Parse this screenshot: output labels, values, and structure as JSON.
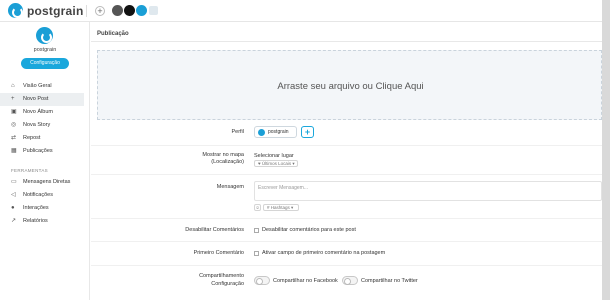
{
  "app": {
    "name": "postgrain"
  },
  "topbar": {
    "add_symbol": "+"
  },
  "profile": {
    "name": "postgrain",
    "config_label": "Configuração"
  },
  "sidebar": {
    "items": [
      {
        "label": "Visão Geral",
        "icon": "home-icon"
      },
      {
        "label": "Novo Post",
        "icon": "plus-icon"
      },
      {
        "label": "Novo Álbum",
        "icon": "album-icon"
      },
      {
        "label": "Nova Story",
        "icon": "story-icon"
      },
      {
        "label": "Repost",
        "icon": "repost-icon"
      },
      {
        "label": "Publicações",
        "icon": "calendar-icon"
      }
    ],
    "section_tools": "FERRAMENTAS",
    "tools": [
      {
        "label": "Mensagens Diretas",
        "icon": "inbox-icon"
      },
      {
        "label": "Notificações",
        "icon": "megaphone-icon"
      },
      {
        "label": "Interações",
        "icon": "globe-icon"
      },
      {
        "label": "Relatórios",
        "icon": "chart-icon"
      }
    ]
  },
  "content": {
    "title": "Publicação",
    "dropzone_text": "Arraste seu arquivo ou Clique Aqui",
    "profile_label": "Perfil",
    "profile_chip": "postgrain",
    "add_profile": "+",
    "map_label_1": "Mostrar no mapa",
    "map_label_2": "(Localização)",
    "select_place": "Selecionar lugar",
    "recent_places": "♥ Últimos Locais ▾",
    "message_label": "Mensagem",
    "message_placeholder": "Escrever Mensagem...",
    "emoji_btn": "☺",
    "hashtag_btn": "# Hashtags ▾",
    "disable_comments_label": "Desabilitar Comentários",
    "disable_comments_option": "Desabilitar comentários para este post",
    "first_comment_label": "Primeiro Comentário",
    "first_comment_option": "Ativar campo de primeiro comentário na postagem",
    "share_label_1": "Compartilhamento",
    "share_label_2": "Configuração",
    "share_facebook": "Compartilhar no Facebook",
    "share_twitter": "Compartilhar no Twitter"
  },
  "colors": {
    "accent": "#1aa7dc",
    "active_nav": "#eceff1"
  }
}
